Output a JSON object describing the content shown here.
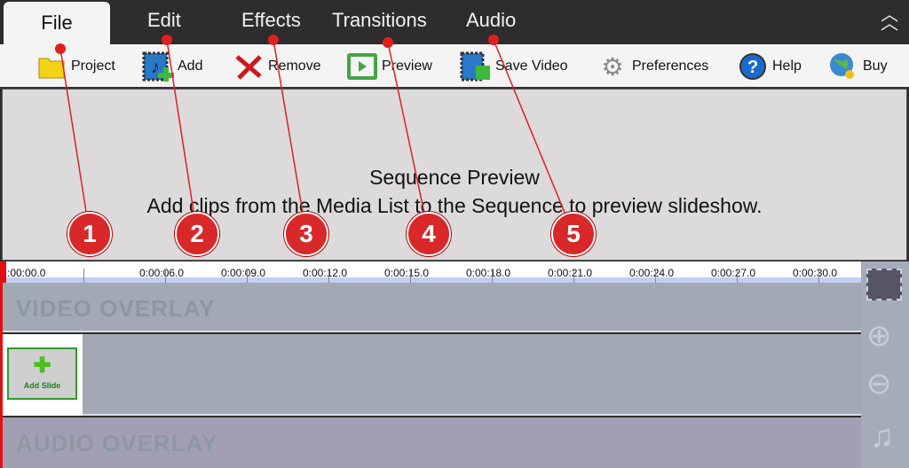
{
  "menu": {
    "tabs": [
      "File",
      "Edit",
      "Effects",
      "Transitions",
      "Audio"
    ],
    "active": "File"
  },
  "toolbar": [
    {
      "label": "Project",
      "icon": "folder-icon"
    },
    {
      "label": "Add",
      "icon": "add-media-icon"
    },
    {
      "label": "Remove",
      "icon": "remove-x-icon"
    },
    {
      "label": "Preview",
      "icon": "play-preview-icon"
    },
    {
      "label": "Save Video",
      "icon": "save-video-icon"
    },
    {
      "label": "Preferences",
      "icon": "gears-icon"
    },
    {
      "label": "Help",
      "icon": "help-icon"
    },
    {
      "label": "Buy",
      "icon": "globe-key-icon"
    }
  ],
  "preview": {
    "title": "Sequence Preview",
    "message": "Add clips from the Media List to the Sequence to preview slideshow."
  },
  "ruler": {
    "ticks": [
      ":00:00.0",
      "0:00:06.0",
      "0:00:09.0",
      "0:00:12.0",
      "0:00:15.0",
      "0:00:18.0",
      "0:00:21.0",
      "0:00:24.0",
      "0:00:27.0",
      "0:00:30.0"
    ]
  },
  "tracks": {
    "video_overlay": "VIDEO OVERLAY",
    "audio_overlay": "AUDIO OVERLAY",
    "add_slide": "Add Slide"
  },
  "annotations": [
    "1",
    "2",
    "3",
    "4",
    "5"
  ],
  "colors": {
    "annotation": "#d8282a",
    "menubar": "#2f2c2d",
    "accent_green": "#2e9a2e"
  }
}
